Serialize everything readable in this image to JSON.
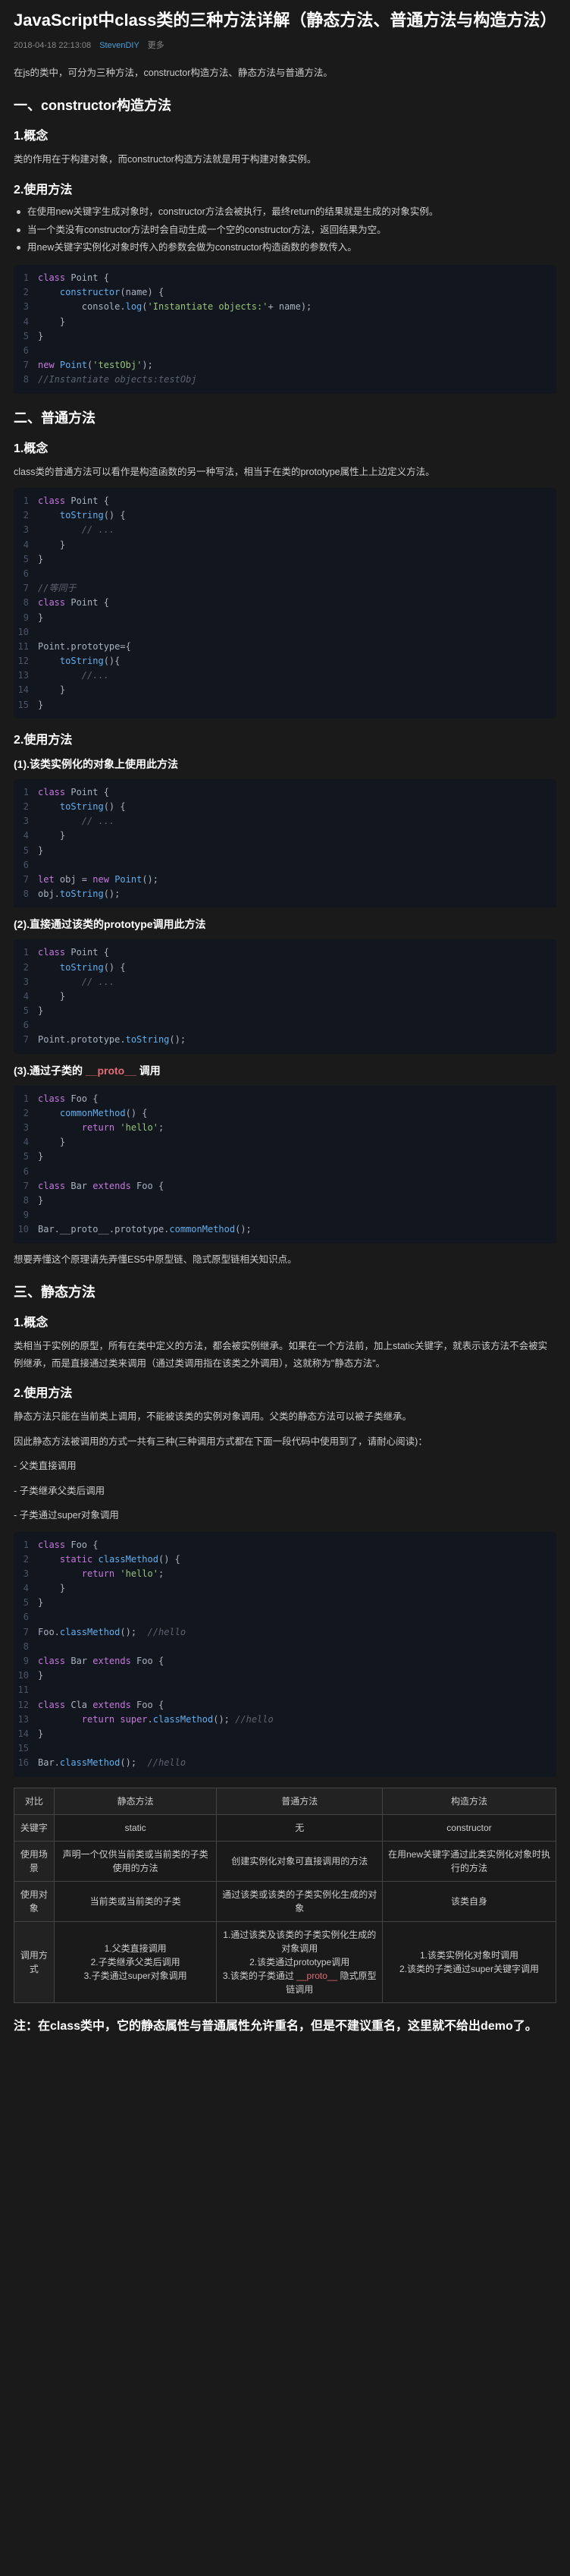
{
  "title": "JavaScript中class类的三种方法详解（静态方法、普通方法与构造方法）",
  "meta": {
    "date": "2018-04-18 22:13:08",
    "author": "StevenDIY",
    "more": "更多"
  },
  "intro": "在js的类中，可分为三种方法，constructor构造方法、静态方法与普通方法。",
  "s1": {
    "h": "一、constructor构造方法",
    "c1h": "1.概念",
    "c1p": "类的作用在于构建对象，而constructor构造方法就是用于构建对象实例。",
    "c2h": "2.使用方法",
    "l1": "在使用new关键字生成对象时，constructor方法会被执行，最终return的结果就是生成的对象实例。",
    "l2": "当一个类没有constructor方法时会自动生成一个空的constructor方法，返回结果为空。",
    "l3": "用new关键字实例化对象时传入的参数会做为constructor构造函数的参数传入。"
  },
  "code1": [
    {
      "n": "1",
      "t": [
        {
          "c": "kw",
          "v": "class"
        },
        {
          "c": "op",
          "v": " Point {"
        }
      ]
    },
    {
      "n": "2",
      "t": [
        {
          "c": "op",
          "v": "    "
        },
        {
          "c": "fn",
          "v": "constructor"
        },
        {
          "c": "op",
          "v": "(name) {"
        }
      ]
    },
    {
      "n": "3",
      "t": [
        {
          "c": "op",
          "v": "        console."
        },
        {
          "c": "fn",
          "v": "log"
        },
        {
          "c": "op",
          "v": "("
        },
        {
          "c": "str",
          "v": "'Instantiate objects:'"
        },
        {
          "c": "op",
          "v": "+ name);"
        }
      ]
    },
    {
      "n": "4",
      "t": [
        {
          "c": "op",
          "v": "    }"
        }
      ]
    },
    {
      "n": "5",
      "t": [
        {
          "c": "op",
          "v": "}"
        }
      ]
    },
    {
      "n": "6",
      "t": [
        {
          "c": "op",
          "v": ""
        }
      ]
    },
    {
      "n": "7",
      "t": [
        {
          "c": "kw",
          "v": "new"
        },
        {
          "c": "op",
          "v": " "
        },
        {
          "c": "fn",
          "v": "Point"
        },
        {
          "c": "op",
          "v": "("
        },
        {
          "c": "str",
          "v": "'testObj'"
        },
        {
          "c": "op",
          "v": ");"
        }
      ]
    },
    {
      "n": "8",
      "t": [
        {
          "c": "cm",
          "v": "//Instantiate objects:testObj"
        }
      ]
    }
  ],
  "s2": {
    "h": "二、普通方法",
    "c1h": "1.概念",
    "c1p": "class类的普通方法可以看作是构造函数的另一种写法，相当于在类的prototype属性上上边定义方法。"
  },
  "code2": [
    {
      "n": "1",
      "t": [
        {
          "c": "kw",
          "v": "class"
        },
        {
          "c": "op",
          "v": " Point {"
        }
      ]
    },
    {
      "n": "2",
      "t": [
        {
          "c": "op",
          "v": "    "
        },
        {
          "c": "fn",
          "v": "toString"
        },
        {
          "c": "op",
          "v": "() {"
        }
      ]
    },
    {
      "n": "3",
      "t": [
        {
          "c": "op",
          "v": "        "
        },
        {
          "c": "cm",
          "v": "// ..."
        }
      ]
    },
    {
      "n": "4",
      "t": [
        {
          "c": "op",
          "v": "    }"
        }
      ]
    },
    {
      "n": "5",
      "t": [
        {
          "c": "op",
          "v": "}"
        }
      ]
    },
    {
      "n": "6",
      "t": [
        {
          "c": "op",
          "v": ""
        }
      ]
    },
    {
      "n": "7",
      "t": [
        {
          "c": "cm",
          "v": "//等同于"
        }
      ]
    },
    {
      "n": "8",
      "t": [
        {
          "c": "kw",
          "v": "class"
        },
        {
          "c": "op",
          "v": " Point {"
        }
      ]
    },
    {
      "n": "9",
      "t": [
        {
          "c": "op",
          "v": "}"
        }
      ]
    },
    {
      "n": "10",
      "t": [
        {
          "c": "op",
          "v": ""
        }
      ]
    },
    {
      "n": "11",
      "t": [
        {
          "c": "op",
          "v": "Point.prototype={"
        }
      ]
    },
    {
      "n": "12",
      "t": [
        {
          "c": "op",
          "v": "    "
        },
        {
          "c": "fn",
          "v": "toString"
        },
        {
          "c": "op",
          "v": "(){"
        }
      ]
    },
    {
      "n": "13",
      "t": [
        {
          "c": "op",
          "v": "        "
        },
        {
          "c": "cm",
          "v": "//..."
        }
      ]
    },
    {
      "n": "14",
      "t": [
        {
          "c": "op",
          "v": "    }"
        }
      ]
    },
    {
      "n": "15",
      "t": [
        {
          "c": "op",
          "v": "}"
        }
      ]
    }
  ],
  "s2b": {
    "c2h": "2.使用方法",
    "u1h": "(1).该类实例化的对象上使用此方法"
  },
  "code3": [
    {
      "n": "1",
      "t": [
        {
          "c": "kw",
          "v": "class"
        },
        {
          "c": "op",
          "v": " Point {"
        }
      ]
    },
    {
      "n": "2",
      "t": [
        {
          "c": "op",
          "v": "    "
        },
        {
          "c": "fn",
          "v": "toString"
        },
        {
          "c": "op",
          "v": "() {"
        }
      ]
    },
    {
      "n": "3",
      "t": [
        {
          "c": "op",
          "v": "        "
        },
        {
          "c": "cm",
          "v": "// ..."
        }
      ]
    },
    {
      "n": "4",
      "t": [
        {
          "c": "op",
          "v": "    }"
        }
      ]
    },
    {
      "n": "5",
      "t": [
        {
          "c": "op",
          "v": "}"
        }
      ]
    },
    {
      "n": "6",
      "t": [
        {
          "c": "op",
          "v": ""
        }
      ]
    },
    {
      "n": "7",
      "t": [
        {
          "c": "kw",
          "v": "let"
        },
        {
          "c": "op",
          "v": " obj = "
        },
        {
          "c": "kw",
          "v": "new"
        },
        {
          "c": "op",
          "v": " "
        },
        {
          "c": "fn",
          "v": "Point"
        },
        {
          "c": "op",
          "v": "();"
        }
      ]
    },
    {
      "n": "8",
      "t": [
        {
          "c": "op",
          "v": "obj."
        },
        {
          "c": "fn",
          "v": "toString"
        },
        {
          "c": "op",
          "v": "();"
        }
      ]
    }
  ],
  "s2c": {
    "u2h": "(2).直接通过该类的prototype调用此方法"
  },
  "code4": [
    {
      "n": "1",
      "t": [
        {
          "c": "kw",
          "v": "class"
        },
        {
          "c": "op",
          "v": " Point {"
        }
      ]
    },
    {
      "n": "2",
      "t": [
        {
          "c": "op",
          "v": "    "
        },
        {
          "c": "fn",
          "v": "toString"
        },
        {
          "c": "op",
          "v": "() {"
        }
      ]
    },
    {
      "n": "3",
      "t": [
        {
          "c": "op",
          "v": "        "
        },
        {
          "c": "cm",
          "v": "// ..."
        }
      ]
    },
    {
      "n": "4",
      "t": [
        {
          "c": "op",
          "v": "    }"
        }
      ]
    },
    {
      "n": "5",
      "t": [
        {
          "c": "op",
          "v": "}"
        }
      ]
    },
    {
      "n": "6",
      "t": [
        {
          "c": "op",
          "v": ""
        }
      ]
    },
    {
      "n": "7",
      "t": [
        {
          "c": "op",
          "v": "Point.prototype."
        },
        {
          "c": "fn",
          "v": "toString"
        },
        {
          "c": "op",
          "v": "();"
        }
      ]
    }
  ],
  "s2d": {
    "u3h_pre": "(3).通过子类的 ",
    "u3h_hl": "__proto__",
    "u3h_post": " 调用"
  },
  "code5": [
    {
      "n": "1",
      "t": [
        {
          "c": "kw",
          "v": "class"
        },
        {
          "c": "op",
          "v": " Foo {"
        }
      ]
    },
    {
      "n": "2",
      "t": [
        {
          "c": "op",
          "v": "    "
        },
        {
          "c": "fn",
          "v": "commonMethod"
        },
        {
          "c": "op",
          "v": "() {"
        }
      ]
    },
    {
      "n": "3",
      "t": [
        {
          "c": "op",
          "v": "        "
        },
        {
          "c": "kw",
          "v": "return"
        },
        {
          "c": "op",
          "v": " "
        },
        {
          "c": "str",
          "v": "'hello'"
        },
        {
          "c": "op",
          "v": ";"
        }
      ]
    },
    {
      "n": "4",
      "t": [
        {
          "c": "op",
          "v": "    }"
        }
      ]
    },
    {
      "n": "5",
      "t": [
        {
          "c": "op",
          "v": "}"
        }
      ]
    },
    {
      "n": "6",
      "t": [
        {
          "c": "op",
          "v": ""
        }
      ]
    },
    {
      "n": "7",
      "t": [
        {
          "c": "kw",
          "v": "class"
        },
        {
          "c": "op",
          "v": " Bar "
        },
        {
          "c": "kw",
          "v": "extends"
        },
        {
          "c": "op",
          "v": " Foo {"
        }
      ]
    },
    {
      "n": "8",
      "t": [
        {
          "c": "op",
          "v": "}"
        }
      ]
    },
    {
      "n": "9",
      "t": [
        {
          "c": "op",
          "v": ""
        }
      ]
    },
    {
      "n": "10",
      "t": [
        {
          "c": "op",
          "v": "Bar.__proto__.prototype."
        },
        {
          "c": "fn",
          "v": "commonMethod"
        },
        {
          "c": "op",
          "v": "();"
        }
      ]
    }
  ],
  "s2e": "想要弄懂这个原理请先弄懂ES5中原型链、隐式原型链相关知识点。",
  "s3": {
    "h": "三、静态方法",
    "c1h": "1.概念",
    "c1p": "类相当于实例的原型，所有在类中定义的方法，都会被实例继承。如果在一个方法前，加上static关键字，就表示该方法不会被实例继承，而是直接通过类来调用（通过类调用指在该类之外调用），这就称为\"静态方法\"。",
    "c2h": "2.使用方法",
    "c2p1": "静态方法只能在当前类上调用，不能被该类的实例对象调用。父类的静态方法可以被子类继承。",
    "c2p2": "因此静态方法被调用的方式一共有三种(三种调用方式都在下面一段代码中使用到了，请耐心阅读)：",
    "l1": "- 父类直接调用",
    "l2": "- 子类继承父类后调用",
    "l3": "- 子类通过super对象调用"
  },
  "code6": [
    {
      "n": "1",
      "t": [
        {
          "c": "kw",
          "v": "class"
        },
        {
          "c": "op",
          "v": " Foo {"
        }
      ]
    },
    {
      "n": "2",
      "t": [
        {
          "c": "op",
          "v": "    "
        },
        {
          "c": "kw",
          "v": "static"
        },
        {
          "c": "op",
          "v": " "
        },
        {
          "c": "fn",
          "v": "classMethod"
        },
        {
          "c": "op",
          "v": "() {"
        }
      ]
    },
    {
      "n": "3",
      "t": [
        {
          "c": "op",
          "v": "        "
        },
        {
          "c": "kw",
          "v": "return"
        },
        {
          "c": "op",
          "v": " "
        },
        {
          "c": "str",
          "v": "'hello'"
        },
        {
          "c": "op",
          "v": ";"
        }
      ]
    },
    {
      "n": "4",
      "t": [
        {
          "c": "op",
          "v": "    }"
        }
      ]
    },
    {
      "n": "5",
      "t": [
        {
          "c": "op",
          "v": "}"
        }
      ]
    },
    {
      "n": "6",
      "t": [
        {
          "c": "op",
          "v": ""
        }
      ]
    },
    {
      "n": "7",
      "t": [
        {
          "c": "op",
          "v": "Foo."
        },
        {
          "c": "fn",
          "v": "classMethod"
        },
        {
          "c": "op",
          "v": "();  "
        },
        {
          "c": "cm",
          "v": "//hello"
        }
      ]
    },
    {
      "n": "8",
      "t": [
        {
          "c": "op",
          "v": ""
        }
      ]
    },
    {
      "n": "9",
      "t": [
        {
          "c": "kw",
          "v": "class"
        },
        {
          "c": "op",
          "v": " Bar "
        },
        {
          "c": "kw",
          "v": "extends"
        },
        {
          "c": "op",
          "v": " Foo {"
        }
      ]
    },
    {
      "n": "10",
      "t": [
        {
          "c": "op",
          "v": "}"
        }
      ]
    },
    {
      "n": "11",
      "t": [
        {
          "c": "op",
          "v": ""
        }
      ]
    },
    {
      "n": "12",
      "t": [
        {
          "c": "kw",
          "v": "class"
        },
        {
          "c": "op",
          "v": " Cla "
        },
        {
          "c": "kw",
          "v": "extends"
        },
        {
          "c": "op",
          "v": " Foo {"
        }
      ]
    },
    {
      "n": "13",
      "t": [
        {
          "c": "op",
          "v": "        "
        },
        {
          "c": "kw",
          "v": "return"
        },
        {
          "c": "op",
          "v": " "
        },
        {
          "c": "kw",
          "v": "super"
        },
        {
          "c": "op",
          "v": "."
        },
        {
          "c": "fn",
          "v": "classMethod"
        },
        {
          "c": "op",
          "v": "(); "
        },
        {
          "c": "cm",
          "v": "//hello"
        }
      ]
    },
    {
      "n": "14",
      "t": [
        {
          "c": "op",
          "v": "}"
        }
      ]
    },
    {
      "n": "15",
      "t": [
        {
          "c": "op",
          "v": ""
        }
      ]
    },
    {
      "n": "16",
      "t": [
        {
          "c": "op",
          "v": "Bar."
        },
        {
          "c": "fn",
          "v": "classMethod"
        },
        {
          "c": "op",
          "v": "();  "
        },
        {
          "c": "cm",
          "v": "//hello"
        }
      ]
    }
  ],
  "table": {
    "head": [
      "对比",
      "静态方法",
      "普通方法",
      "构造方法"
    ],
    "rows": [
      [
        "关键字",
        "static",
        "无",
        "constructor"
      ],
      [
        "使用场景",
        "声明一个仅供当前类或当前类的子类使用的方法",
        "创建实例化对象可直接调用的方法",
        "在用new关键字通过此类实例化对象时执行的方法"
      ],
      [
        "使用对象",
        "当前类或当前类的子类",
        "通过该类或该类的子类实例化生成的对象",
        "该类自身"
      ],
      [
        "调用方式",
        "1.父类直接调用\n2.子类继承父类后调用\n3.子类通过super对象调用",
        "1.通过该类及该类的子类实例化生成的对象调用\n2.该类通过prototype调用\n3.该类的子类通过 __proto__ 隐式原型链调用",
        "1.该类实例化对象时调用\n2.该类的子类通过super关键字调用"
      ]
    ]
  },
  "note": "注：在class类中，它的静态属性与普通属性允许重名，但是不建议重名，这里就不给出demo了。"
}
